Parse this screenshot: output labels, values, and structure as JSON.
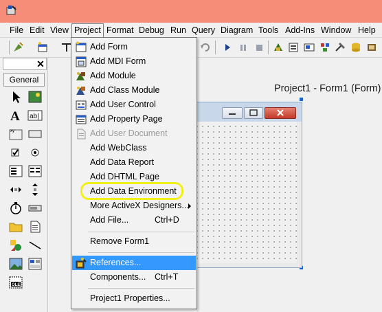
{
  "menubar": {
    "items": [
      "File",
      "Edit",
      "View",
      "Project",
      "Format",
      "Debug",
      "Run",
      "Query",
      "Diagram",
      "Tools",
      "Add-Ins",
      "Window",
      "Help"
    ],
    "open_item": "Project"
  },
  "toolbox": {
    "close_glyph": "✕",
    "tab_label": "General",
    "tools": [
      "pointer-icon",
      "picturebox-icon",
      "label-icon",
      "textbox-icon",
      "frame-icon",
      "commandbutton-icon",
      "checkbox-icon",
      "optionbutton-icon",
      "combobox-icon",
      "listbox-icon",
      "hscrollbar-icon",
      "vscrollbar-icon",
      "timer-icon",
      "drivelistbox-icon",
      "dirlistbox-icon",
      "filelistbox-icon",
      "shape-icon",
      "line-icon",
      "image-icon",
      "data-icon",
      "ole-icon"
    ]
  },
  "designer": {
    "form_caption": "Project1 - Form1 (Form)"
  },
  "project_menu": {
    "items": [
      {
        "label": "Add Form",
        "icon": "form-icon",
        "enabled": true,
        "shortcut": "",
        "submenu": false
      },
      {
        "label": "Add MDI Form",
        "icon": "mdi-form-icon",
        "enabled": true,
        "shortcut": "",
        "submenu": false
      },
      {
        "label": "Add Module",
        "icon": "module-icon",
        "enabled": true,
        "shortcut": "",
        "submenu": false
      },
      {
        "label": "Add Class Module",
        "icon": "class-module-icon",
        "enabled": true,
        "shortcut": "",
        "submenu": false
      },
      {
        "label": "Add User Control",
        "icon": "user-control-icon",
        "enabled": true,
        "shortcut": "",
        "submenu": false
      },
      {
        "label": "Add Property Page",
        "icon": "property-page-icon",
        "enabled": true,
        "shortcut": "",
        "submenu": false
      },
      {
        "label": "Add User Document",
        "icon": "user-document-icon",
        "enabled": false,
        "shortcut": "",
        "submenu": false
      },
      {
        "label": "Add WebClass",
        "icon": "",
        "enabled": true,
        "shortcut": "",
        "submenu": false
      },
      {
        "label": "Add Data Report",
        "icon": "",
        "enabled": true,
        "shortcut": "",
        "submenu": false
      },
      {
        "label": "Add DHTML Page",
        "icon": "",
        "enabled": true,
        "shortcut": "",
        "submenu": false
      },
      {
        "label": "Add Data Environment",
        "icon": "",
        "enabled": true,
        "shortcut": "",
        "submenu": false,
        "circled": true
      },
      {
        "label": "More ActiveX Designers...",
        "icon": "",
        "enabled": true,
        "shortcut": "",
        "submenu": true
      },
      {
        "label": "Add File...",
        "icon": "",
        "enabled": true,
        "shortcut": "Ctrl+D",
        "submenu": false
      },
      {
        "label": "Remove Form1",
        "icon": "",
        "enabled": true,
        "shortcut": "",
        "submenu": false
      },
      {
        "label": "References...",
        "icon": "references-icon",
        "enabled": true,
        "shortcut": "",
        "submenu": false,
        "highlighted": true
      },
      {
        "label": "Components...",
        "icon": "",
        "enabled": true,
        "shortcut": "Ctrl+T",
        "submenu": false
      },
      {
        "label": "Project1 Properties...",
        "icon": "",
        "enabled": true,
        "shortcut": "",
        "submenu": false
      }
    ]
  },
  "colors": {
    "titlebar": "#f58d78",
    "menu_highlight": "#3399ff",
    "callout_ring": "#f2f01a"
  }
}
